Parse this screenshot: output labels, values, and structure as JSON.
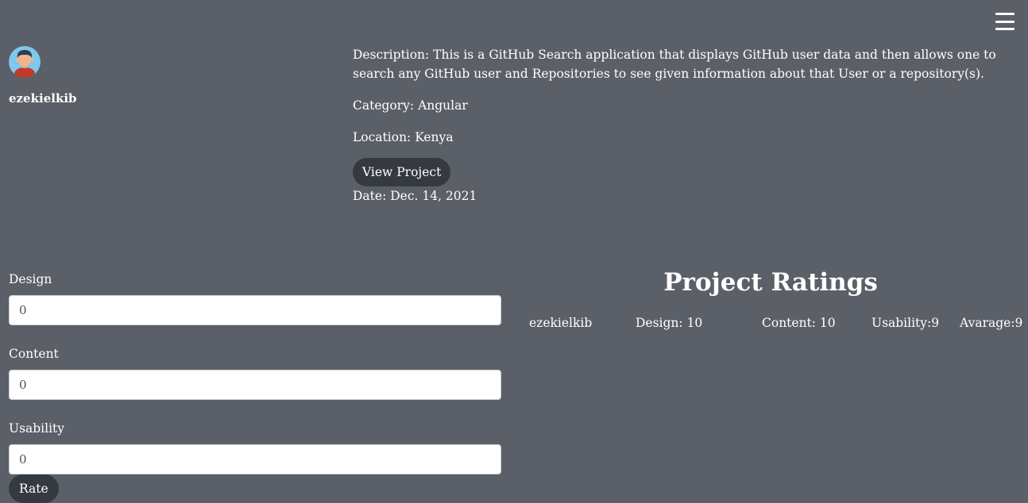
{
  "header": {
    "menu_icon": "hamburger-menu-icon"
  },
  "profile": {
    "avatar_icon": "user-avatar-icon",
    "username": "ezekielkib"
  },
  "project": {
    "description": "Description: This is a GitHub Search application that displays GitHub user data and then allows one to search any GitHub user and Repositories to see given information about that User or a repository(s).",
    "category": "Category: Angular",
    "location": "Location: Kenya",
    "view_button_label": "View Project",
    "date": "Date: Dec. 14, 2021"
  },
  "rating_form": {
    "design_label": "Design",
    "design_value": "0",
    "content_label": "Content",
    "content_value": "0",
    "usability_label": "Usability",
    "usability_value": "0",
    "submit_label": "Rate"
  },
  "ratings": {
    "title": "Project Ratings",
    "rows": [
      {
        "user": "ezekielkib",
        "design": "Design: 10",
        "content": "Content: 10",
        "usability": "Usability:9",
        "average": "Avarage:9"
      }
    ]
  },
  "colors": {
    "background": "#5b5f67",
    "button": "#343a40",
    "text": "#ffffff"
  }
}
